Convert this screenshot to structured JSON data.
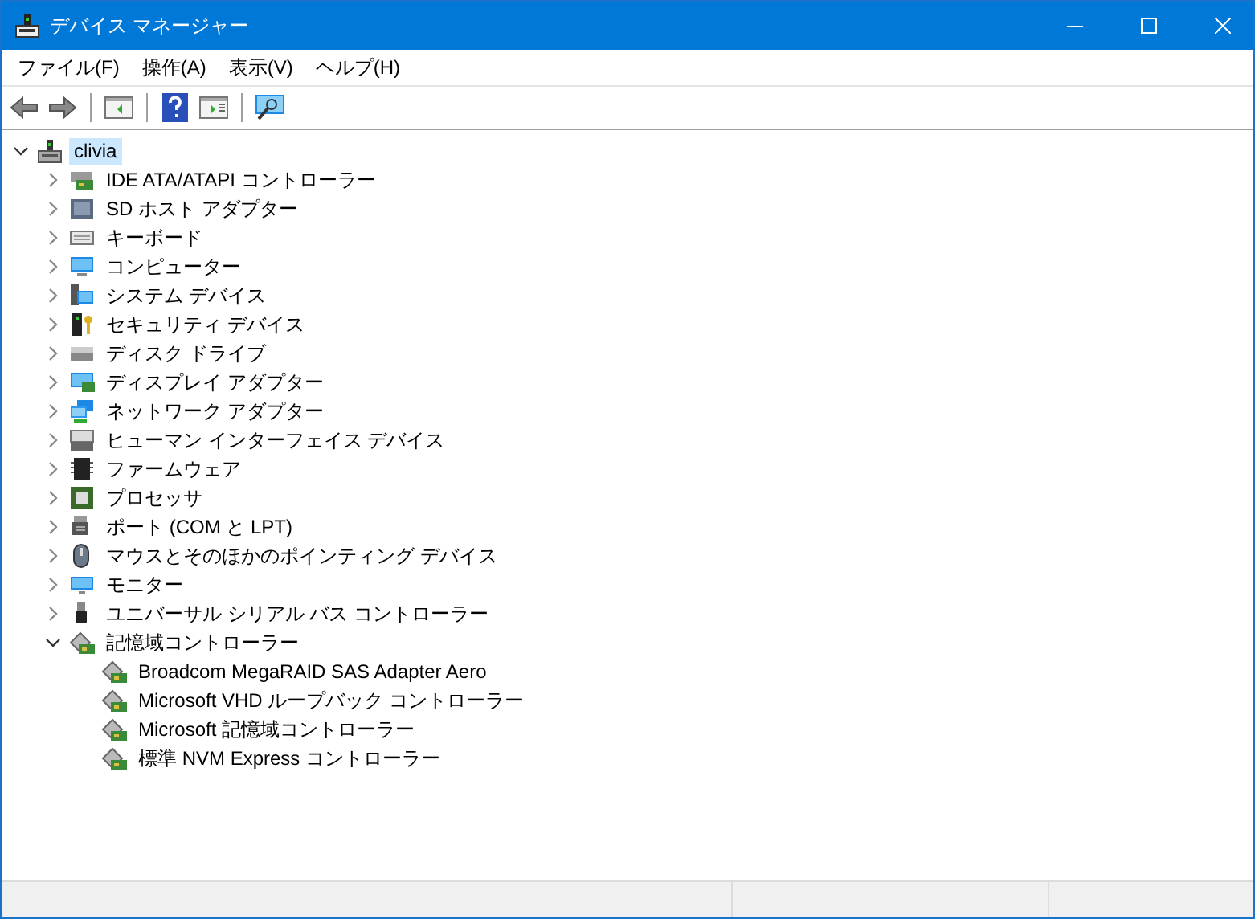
{
  "window": {
    "title": "デバイス マネージャー"
  },
  "menu": [
    "ファイル(F)",
    "操作(A)",
    "表示(V)",
    "ヘルプ(H)"
  ],
  "tree": {
    "label": "clivia",
    "expanded": true,
    "selected": true,
    "children": [
      {
        "label": "IDE ATA/ATAPI コントローラー",
        "kind": "ide",
        "expanded": false,
        "selected": false
      },
      {
        "label": "SD ホスト アダプター",
        "kind": "sd",
        "expanded": false,
        "selected": false
      },
      {
        "label": "キーボード",
        "kind": "keyboard",
        "expanded": false,
        "selected": false
      },
      {
        "label": "コンピューター",
        "kind": "computer",
        "expanded": false,
        "selected": false
      },
      {
        "label": "システム デバイス",
        "kind": "system",
        "expanded": false,
        "selected": false
      },
      {
        "label": "セキュリティ デバイス",
        "kind": "security",
        "expanded": false,
        "selected": false
      },
      {
        "label": "ディスク ドライブ",
        "kind": "disk",
        "expanded": false,
        "selected": false
      },
      {
        "label": "ディスプレイ アダプター",
        "kind": "display",
        "expanded": false,
        "selected": false
      },
      {
        "label": "ネットワーク アダプター",
        "kind": "network",
        "expanded": false,
        "selected": false
      },
      {
        "label": "ヒューマン インターフェイス デバイス",
        "kind": "hid",
        "expanded": false,
        "selected": false
      },
      {
        "label": "ファームウェア",
        "kind": "firmware",
        "expanded": false,
        "selected": false
      },
      {
        "label": "プロセッサ",
        "kind": "processor",
        "expanded": false,
        "selected": false
      },
      {
        "label": "ポート (COM と LPT)",
        "kind": "port",
        "expanded": false,
        "selected": false
      },
      {
        "label": "マウスとそのほかのポインティング デバイス",
        "kind": "mouse",
        "expanded": false,
        "selected": false
      },
      {
        "label": "モニター",
        "kind": "monitor",
        "expanded": false,
        "selected": false
      },
      {
        "label": "ユニバーサル シリアル バス コントローラー",
        "kind": "usb",
        "expanded": false,
        "selected": false
      },
      {
        "label": "記憶域コントローラー",
        "kind": "storage",
        "expanded": true,
        "selected": false,
        "children": [
          {
            "label": "Broadcom MegaRAID SAS Adapter Aero",
            "kind": "storage",
            "selected": false
          },
          {
            "label": "Microsoft VHD ループバック コントローラー",
            "kind": "storage",
            "selected": false
          },
          {
            "label": "Microsoft 記憶域コントローラー",
            "kind": "storage",
            "selected": false
          },
          {
            "label": "標準 NVM Express コントローラー",
            "kind": "storage",
            "selected": false
          }
        ]
      }
    ]
  }
}
